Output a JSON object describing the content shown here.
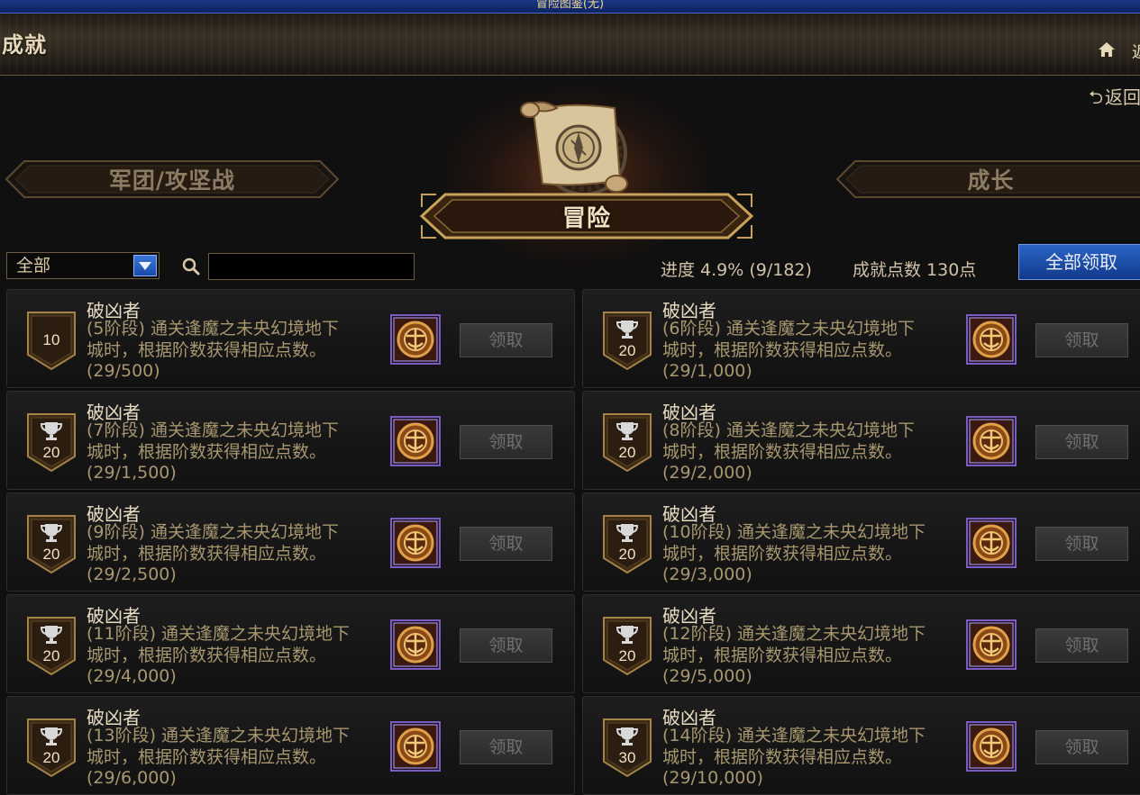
{
  "window": {
    "title": "冒险图鉴(无)"
  },
  "header": {
    "title": "成就",
    "close_hint": "返"
  },
  "back_label": "返回",
  "icons": {
    "home": "home-icon",
    "back": "return-arrow-icon",
    "search": "search-icon",
    "scroll": "compass-scroll-icon",
    "reward": "medallion-icon",
    "trophy": "trophy-icon"
  },
  "categories": {
    "left": "军团/攻坚战",
    "center": "冒险",
    "right": "成长"
  },
  "filter": {
    "selected": "全部"
  },
  "search": {
    "value": "",
    "placeholder": ""
  },
  "progress": {
    "label": "进度",
    "percent": "4.9%",
    "count": "(9/182)",
    "text": "进度  4.9% (9/182)"
  },
  "points": {
    "text": "成就点数 130点"
  },
  "claim_all_label": "全部领取",
  "colors": {
    "accent_blue": "#1a4aa8",
    "gold": "#c9a25a",
    "purple_frame": "#7a5cc0"
  },
  "achievements": [
    {
      "title": "破凶者",
      "line1": "(5阶段) 通关逢魔之未央幻境地下",
      "line2": "城时，根据阶数获得相应点数。",
      "progress": "(29/500)",
      "points": "10",
      "trophy": false,
      "claim_label": "领取"
    },
    {
      "title": "破凶者",
      "line1": "(6阶段) 通关逢魔之未央幻境地下",
      "line2": "城时，根据阶数获得相应点数。",
      "progress": "(29/1,000)",
      "points": "20",
      "trophy": true,
      "claim_label": "领取"
    },
    {
      "title": "破凶者",
      "line1": "(7阶段) 通关逢魔之未央幻境地下",
      "line2": "城时，根据阶数获得相应点数。",
      "progress": "(29/1,500)",
      "points": "20",
      "trophy": true,
      "claim_label": "领取"
    },
    {
      "title": "破凶者",
      "line1": "(8阶段) 通关逢魔之未央幻境地下",
      "line2": "城时，根据阶数获得相应点数。",
      "progress": "(29/2,000)",
      "points": "20",
      "trophy": true,
      "claim_label": "领取"
    },
    {
      "title": "破凶者",
      "line1": "(9阶段) 通关逢魔之未央幻境地下",
      "line2": "城时，根据阶数获得相应点数。",
      "progress": "(29/2,500)",
      "points": "20",
      "trophy": true,
      "claim_label": "领取"
    },
    {
      "title": "破凶者",
      "line1": "(10阶段) 通关逢魔之未央幻境地下",
      "line2": "城时，根据阶数获得相应点数。",
      "progress": "(29/3,000)",
      "points": "20",
      "trophy": true,
      "claim_label": "领取"
    },
    {
      "title": "破凶者",
      "line1": "(11阶段) 通关逢魔之未央幻境地下",
      "line2": "城时，根据阶数获得相应点数。",
      "progress": "(29/4,000)",
      "points": "20",
      "trophy": true,
      "claim_label": "领取"
    },
    {
      "title": "破凶者",
      "line1": "(12阶段) 通关逢魔之未央幻境地下",
      "line2": "城时，根据阶数获得相应点数。",
      "progress": "(29/5,000)",
      "points": "20",
      "trophy": true,
      "claim_label": "领取"
    },
    {
      "title": "破凶者",
      "line1": "(13阶段) 通关逢魔之未央幻境地下",
      "line2": "城时，根据阶数获得相应点数。",
      "progress": "(29/6,000)",
      "points": "20",
      "trophy": true,
      "claim_label": "领取"
    },
    {
      "title": "破凶者",
      "line1": "(14阶段) 通关逢魔之未央幻境地下",
      "line2": "城时，根据阶数获得相应点数。",
      "progress": "(29/10,000)",
      "points": "30",
      "trophy": true,
      "claim_label": "领取"
    }
  ]
}
